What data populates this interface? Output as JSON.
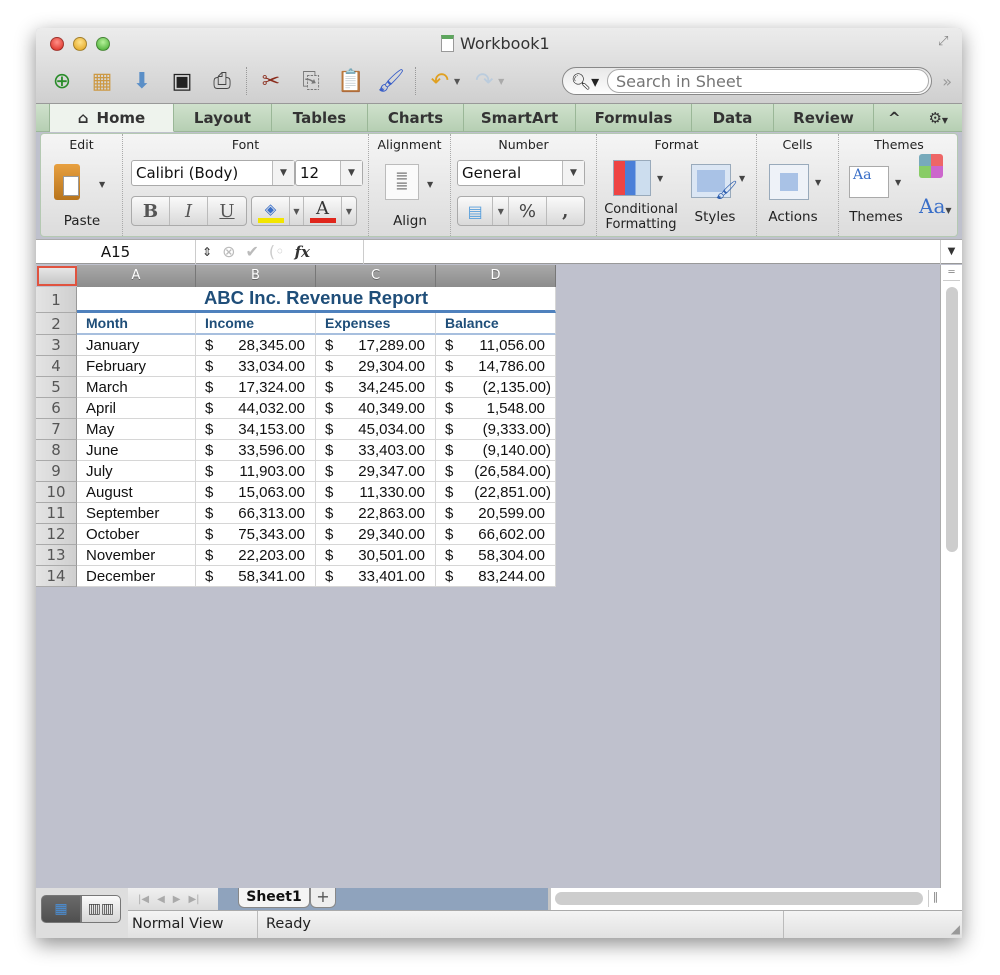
{
  "window": {
    "title": "Workbook1",
    "controls": [
      "close",
      "minimize",
      "zoom"
    ]
  },
  "toolbar": {
    "buttons": [
      {
        "name": "new-workbook",
        "glyph": "📄"
      },
      {
        "name": "gallery",
        "glyph": "▦"
      },
      {
        "name": "open",
        "glyph": "📂"
      },
      {
        "name": "save",
        "glyph": "💾"
      },
      {
        "name": "print",
        "glyph": "🖨"
      },
      {
        "name": "cut",
        "glyph": "✂"
      },
      {
        "name": "copy",
        "glyph": "⎘"
      },
      {
        "name": "paste",
        "glyph": "📋"
      },
      {
        "name": "format-painter",
        "glyph": "🖌"
      },
      {
        "name": "undo",
        "glyph": "↶"
      },
      {
        "name": "redo",
        "glyph": "↷"
      }
    ],
    "search": {
      "placeholder": "Search in Sheet",
      "value": ""
    },
    "overflow_glyph": "»"
  },
  "ribbon": {
    "tabs": [
      {
        "label": "Home",
        "active": true
      },
      {
        "label": "Layout"
      },
      {
        "label": "Tables"
      },
      {
        "label": "Charts"
      },
      {
        "label": "SmartArt"
      },
      {
        "label": "Formulas"
      },
      {
        "label": "Data"
      },
      {
        "label": "Review"
      }
    ],
    "collapse_glyph": "^",
    "settings_glyph": "⚙",
    "groups": {
      "edit": {
        "label": "Edit",
        "paste": "Paste"
      },
      "font": {
        "label": "Font",
        "font_name": "Calibri (Body)",
        "font_size": "12",
        "bold": "B",
        "italic": "I",
        "underline": "U",
        "font_color_glyph": "A",
        "highlight_color": "#f2e500",
        "font_color": "#e0261c"
      },
      "alignment": {
        "label": "Alignment",
        "align": "Align"
      },
      "number": {
        "label": "Number",
        "format": "General",
        "percent": "%",
        "comma": ","
      },
      "format": {
        "label": "Format",
        "conditional": "Conditional Formatting",
        "styles": "Styles"
      },
      "cells": {
        "label": "Cells",
        "actions": "Actions"
      },
      "themes": {
        "label": "Themes",
        "themes": "Themes",
        "fonts_glyph": "Aa"
      }
    }
  },
  "formula_bar": {
    "name_box": "A15",
    "fx": "fx",
    "formula": ""
  },
  "sheet": {
    "columns": [
      "A",
      "B",
      "C",
      "D"
    ],
    "title": "ABC Inc. Revenue Report",
    "headers": [
      "Month",
      "Income",
      "Expenses",
      "Balance"
    ],
    "currency_symbol": "$",
    "rows": [
      {
        "row": "3",
        "month": "January",
        "income": "28,345.00",
        "expenses": "17,289.00",
        "balance": "11,056.00"
      },
      {
        "row": "4",
        "month": "February",
        "income": "33,034.00",
        "expenses": "29,304.00",
        "balance": "14,786.00"
      },
      {
        "row": "5",
        "month": "March",
        "income": "17,324.00",
        "expenses": "34,245.00",
        "balance": "(2,135.00)"
      },
      {
        "row": "6",
        "month": "April",
        "income": "44,032.00",
        "expenses": "40,349.00",
        "balance": "1,548.00"
      },
      {
        "row": "7",
        "month": "May",
        "income": "34,153.00",
        "expenses": "45,034.00",
        "balance": "(9,333.00)"
      },
      {
        "row": "8",
        "month": "June",
        "income": "33,596.00",
        "expenses": "33,403.00",
        "balance": "(9,140.00)"
      },
      {
        "row": "9",
        "month": "July",
        "income": "11,903.00",
        "expenses": "29,347.00",
        "balance": "(26,584.00)"
      },
      {
        "row": "10",
        "month": "August",
        "income": "15,063.00",
        "expenses": "11,330.00",
        "balance": "(22,851.00)"
      },
      {
        "row": "11",
        "month": "September",
        "income": "66,313.00",
        "expenses": "22,863.00",
        "balance": "20,599.00"
      },
      {
        "row": "12",
        "month": "October",
        "income": "75,343.00",
        "expenses": "29,340.00",
        "balance": "66,602.00"
      },
      {
        "row": "13",
        "month": "November",
        "income": "22,203.00",
        "expenses": "30,501.00",
        "balance": "58,304.00"
      },
      {
        "row": "14",
        "month": "December",
        "income": "58,341.00",
        "expenses": "33,401.00",
        "balance": "83,244.00"
      }
    ],
    "row_numbers_header": [
      "1",
      "2"
    ]
  },
  "sheet_tabs": {
    "tabs": [
      "Sheet1"
    ],
    "add": "+"
  },
  "status": {
    "view": "Normal View",
    "state": "Ready"
  }
}
